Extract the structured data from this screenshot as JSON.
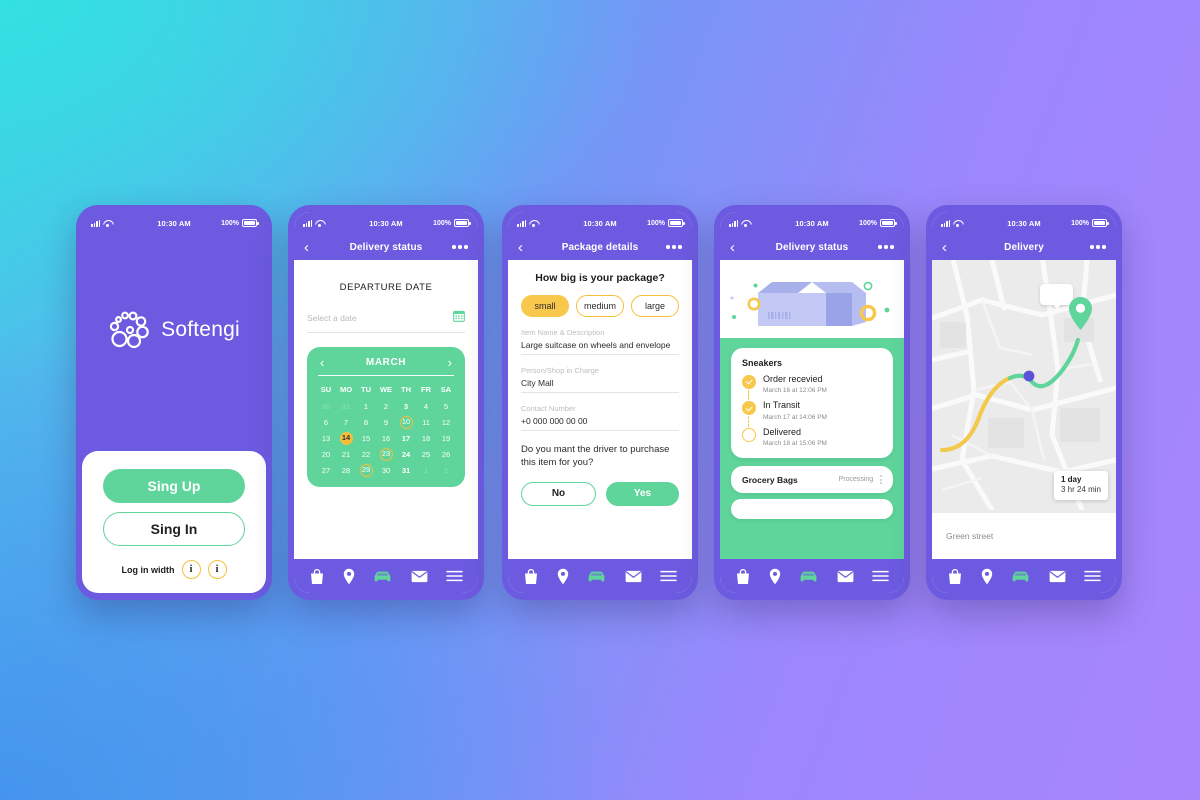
{
  "statusbar": {
    "time": "10:30 AM",
    "battery": "100%"
  },
  "phones": [
    {
      "id": "login",
      "brand": "Softengi",
      "signup_label": "Sing Up",
      "signin_label": "Sing In",
      "login_with_label": "Log in width",
      "social_glyphs": [
        "i",
        "i"
      ]
    },
    {
      "id": "departure-date",
      "title": "Delivery status",
      "section_title": "DEPARTURE DATE",
      "date_placeholder": "Select a date",
      "calendar": {
        "month": "MARCH",
        "dow": [
          "SU",
          "MO",
          "TU",
          "WE",
          "TH",
          "FR",
          "SA"
        ],
        "weeks": [
          [
            {
              "d": "30",
              "state": "muted"
            },
            {
              "d": "31",
              "state": "muted"
            },
            {
              "d": "1",
              "state": "normal"
            },
            {
              "d": "2",
              "state": "normal"
            },
            {
              "d": "3",
              "state": "bold"
            },
            {
              "d": "4",
              "state": "normal"
            },
            {
              "d": "5",
              "state": "normal"
            }
          ],
          [
            {
              "d": "6",
              "state": "normal"
            },
            {
              "d": "7",
              "state": "normal"
            },
            {
              "d": "8",
              "state": "normal"
            },
            {
              "d": "9",
              "state": "normal"
            },
            {
              "d": "10",
              "state": "ring"
            },
            {
              "d": "11",
              "state": "normal"
            },
            {
              "d": "12",
              "state": "normal"
            }
          ],
          [
            {
              "d": "13",
              "state": "normal"
            },
            {
              "d": "14",
              "state": "fill"
            },
            {
              "d": "15",
              "state": "normal"
            },
            {
              "d": "16",
              "state": "normal"
            },
            {
              "d": "17",
              "state": "bold"
            },
            {
              "d": "18",
              "state": "normal"
            },
            {
              "d": "19",
              "state": "normal"
            }
          ],
          [
            {
              "d": "20",
              "state": "normal"
            },
            {
              "d": "21",
              "state": "normal"
            },
            {
              "d": "22",
              "state": "normal"
            },
            {
              "d": "23",
              "state": "ring"
            },
            {
              "d": "24",
              "state": "bold"
            },
            {
              "d": "25",
              "state": "normal"
            },
            {
              "d": "26",
              "state": "normal"
            }
          ],
          [
            {
              "d": "27",
              "state": "normal"
            },
            {
              "d": "28",
              "state": "normal"
            },
            {
              "d": "29",
              "state": "ring"
            },
            {
              "d": "30",
              "state": "normal"
            },
            {
              "d": "31",
              "state": "bold"
            },
            {
              "d": "1",
              "state": "muted"
            },
            {
              "d": "2",
              "state": "muted"
            }
          ]
        ]
      }
    },
    {
      "id": "package-details",
      "title": "Package details",
      "question": "How big is your package?",
      "sizes": [
        {
          "label": "small",
          "selected": true
        },
        {
          "label": "medium",
          "selected": false
        },
        {
          "label": "large",
          "selected": false
        }
      ],
      "fields": [
        {
          "label": "Item Name & Description",
          "value": "Large suitcase on wheels and envelope"
        },
        {
          "label": "Person/Shop in Charge",
          "value": "City Mall"
        },
        {
          "label": "Contact Number",
          "value": "+0 000 000 00 00"
        }
      ],
      "ask": "Do you mant the driver to purchase this item for you?",
      "no_label": "No",
      "yes_label": "Yes"
    },
    {
      "id": "delivery-status",
      "title": "Delivery status",
      "order_title": "Sneakers",
      "steps": [
        {
          "label": "Order recevied",
          "date": "March 16 at 12:06 PM",
          "done": true
        },
        {
          "label": "In Transit",
          "date": "March 17 at 14:06 PM",
          "done": true
        },
        {
          "label": "Delivered",
          "date": "March 18 at 15:06 PM",
          "done": false
        }
      ],
      "second_order": {
        "name": "Grocery Bags",
        "status": "Processing"
      }
    },
    {
      "id": "delivery-map",
      "title": "Delivery",
      "eta_days": "1 day",
      "eta_time": "3 hr  24 min",
      "street": "Green street"
    }
  ],
  "tabbar": {
    "items": [
      {
        "icon": "shopping-bag-icon",
        "active": false
      },
      {
        "icon": "location-pin-icon",
        "active": false
      },
      {
        "icon": "car-icon",
        "active": true
      },
      {
        "icon": "envelope-icon",
        "active": false
      },
      {
        "icon": "hamburger-menu-icon",
        "active": false
      }
    ]
  },
  "colors": {
    "purple": "#6C5BE0",
    "green": "#5FD49B",
    "yellow": "#F7C84B",
    "bg_cyan": "#33E1E1",
    "bg_blue": "#4494EE",
    "bg_purple": "#A985FC"
  }
}
